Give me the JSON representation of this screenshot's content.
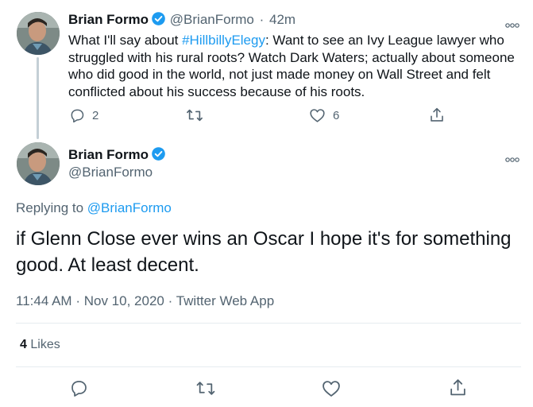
{
  "colors": {
    "accent": "#1d9bf0",
    "text_primary": "#0f1419",
    "text_secondary": "#536471",
    "divider": "#e6ecf0",
    "thread_line": "#c4cfd6"
  },
  "parent_tweet": {
    "author_name": "Brian Formo",
    "handle": "@BrianFormo",
    "separator": "·",
    "time_ago": "42m",
    "text_before_hashtag": "What I'll say about ",
    "hashtag": "#HillbillyElegy",
    "text_after_hashtag": ": Want to see an Ivy League lawyer who struggled with his rural roots? Watch Dark Waters; actually about someone who did good in the world, not just made money on Wall Street and felt conflicted about his success because of his roots.",
    "reply_count": "2",
    "retweet_count": "",
    "like_count": "6",
    "icons": [
      "reply-icon",
      "retweet-icon",
      "like-icon",
      "share-icon",
      "more-icon",
      "verified-icon"
    ]
  },
  "main_tweet": {
    "author_name": "Brian Formo",
    "handle": "@BrianFormo",
    "replying_prefix": "Replying to ",
    "replying_to": "@BrianFormo",
    "text": "if Glenn Close ever wins an Oscar I hope it's for something good. At least decent.",
    "time": "11:44 AM",
    "date": "Nov 10, 2020",
    "source": "Twitter Web App",
    "meta_separator": "·",
    "likes_count": "4",
    "likes_label": "Likes"
  }
}
